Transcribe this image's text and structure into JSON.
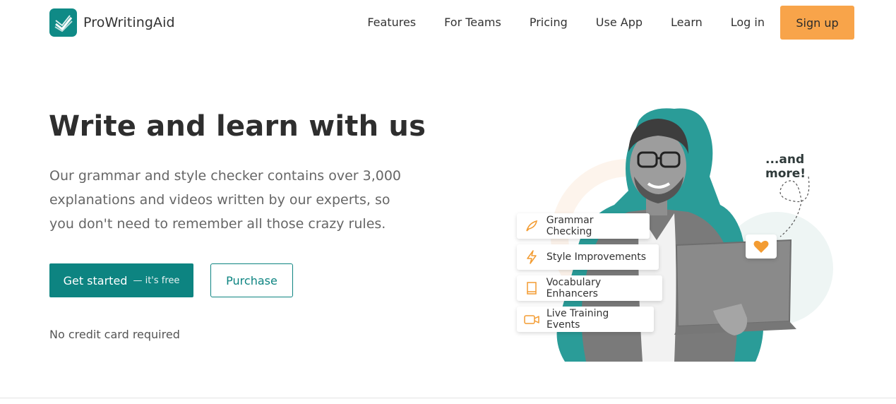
{
  "brand": {
    "name": "ProWritingAid",
    "accent": "#0f8a86",
    "cta": "#f8a44a"
  },
  "nav": {
    "items": [
      "Features",
      "For Teams",
      "Pricing",
      "Use App",
      "Learn"
    ],
    "login": "Log in",
    "signup": "Sign up"
  },
  "hero": {
    "title": "Write and learn with us",
    "description": "Our grammar and style checker contains over 3,000 explanations and videos written by our experts, so you don't need to remember all those crazy rules.",
    "primary_button": "Get started",
    "primary_button_sub": "— it's free",
    "secondary_button": "Purchase",
    "note": "No credit card required"
  },
  "illustration": {
    "callout": "...and more!",
    "features": [
      {
        "label": "Grammar Checking",
        "icon": "quill-icon"
      },
      {
        "label": "Style Improvements",
        "icon": "lightning-icon"
      },
      {
        "label": "Vocabulary Enhancers",
        "icon": "book-icon"
      },
      {
        "label": "Live Training Events",
        "icon": "video-camera-icon"
      }
    ],
    "badge_icon": "heart-icon"
  }
}
